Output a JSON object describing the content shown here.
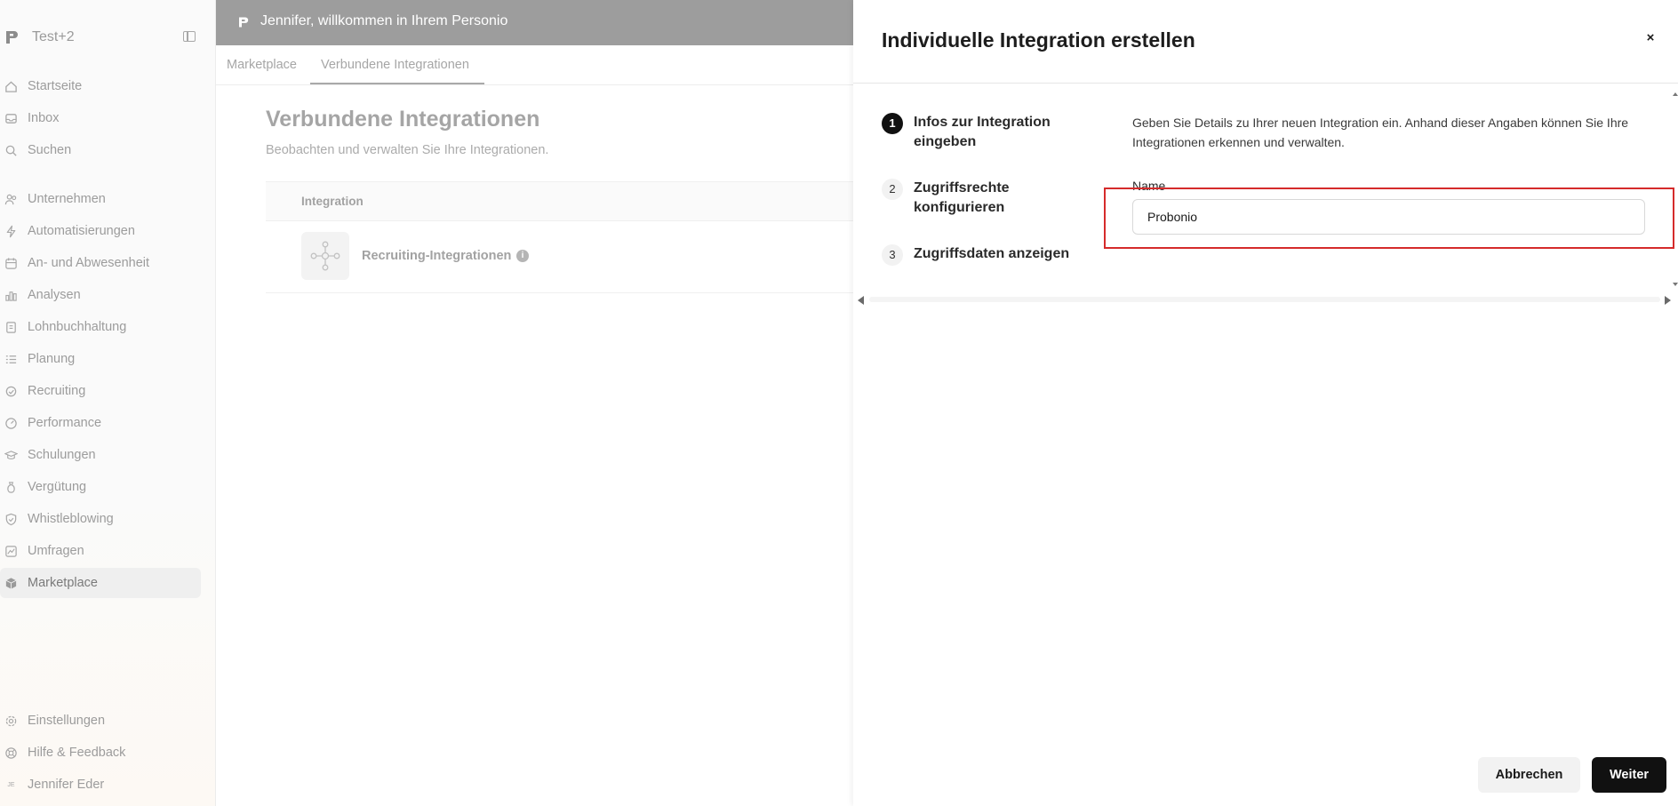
{
  "sidebar": {
    "company": "Test+2",
    "items": [
      {
        "label": "Startseite",
        "icon": "home-icon"
      },
      {
        "label": "Inbox",
        "icon": "inbox-icon"
      },
      {
        "label": "Suchen",
        "icon": "search-icon"
      },
      {
        "label": "Unternehmen",
        "icon": "people-icon"
      },
      {
        "label": "Automatisierungen",
        "icon": "lightning-icon"
      },
      {
        "label": "An- und Abwesenheit",
        "icon": "calendar-icon"
      },
      {
        "label": "Analysen",
        "icon": "bar-chart-icon"
      },
      {
        "label": "Lohnbuchhaltung",
        "icon": "payroll-icon"
      },
      {
        "label": "Planung",
        "icon": "list-icon"
      },
      {
        "label": "Recruiting",
        "icon": "recruiting-icon"
      },
      {
        "label": "Performance",
        "icon": "gauge-icon"
      },
      {
        "label": "Schulungen",
        "icon": "graduation-cap-icon"
      },
      {
        "label": "Vergütung",
        "icon": "money-bag-icon"
      },
      {
        "label": "Whistleblowing",
        "icon": "shield-check-icon"
      },
      {
        "label": "Umfragen",
        "icon": "survey-chart-icon"
      },
      {
        "label": "Marketplace",
        "icon": "cube-icon"
      }
    ],
    "footer": [
      {
        "label": "Einstellungen",
        "icon": "gear-icon"
      },
      {
        "label": "Hilfe & Feedback",
        "icon": "lifebuoy-icon"
      },
      {
        "label": "Jennifer Eder",
        "icon": "avatar-initials",
        "initials": "JE"
      }
    ],
    "active": "Marketplace"
  },
  "banner": {
    "text": "Jennifer, willkommen in Ihrem Personio"
  },
  "page": {
    "tabs": [
      "Marketplace",
      "Verbundene Integrationen"
    ],
    "active_tab": "Verbundene Integrationen",
    "title": "Verbundene Integrationen",
    "subtitle": "Beobachten und verwalten Sie Ihre Integrationen.",
    "table": {
      "header": "Integration",
      "rows": [
        {
          "name": "Recruiting-Integrationen",
          "info_icon": "i"
        }
      ]
    }
  },
  "panel": {
    "title": "Individuelle Integration erstellen",
    "close": "×",
    "steps": [
      {
        "number": "1",
        "label": "Infos zur Integration eingeben",
        "active": true
      },
      {
        "number": "2",
        "label": "Zugriffsrechte konfigurieren",
        "active": false
      },
      {
        "number": "3",
        "label": "Zugriffsdaten anzeigen",
        "active": false
      }
    ],
    "description": "Geben Sie Details zu Ihrer neuen Integration ein. Anhand dieser Angaben können Sie Ihre Integrationen erkennen und verwalten.",
    "name_field": {
      "label": "Name",
      "value": "Probonio"
    },
    "buttons": {
      "cancel": "Abbrechen",
      "next": "Weiter"
    }
  },
  "colors": {
    "banner": "#9d9d9d",
    "primary_button": "#111111",
    "highlight": "#d52b2b"
  }
}
